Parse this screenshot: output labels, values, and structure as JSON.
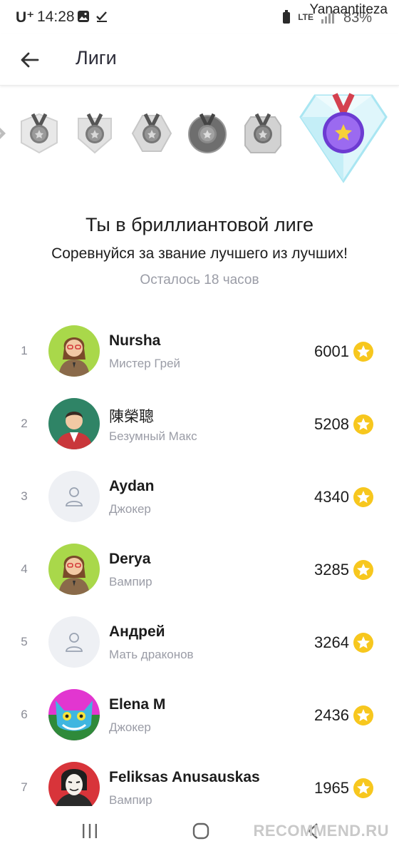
{
  "status_bar": {
    "carrier": "U⁺",
    "time": "14:28",
    "battery": "83%",
    "network": "LTE",
    "watermark": "Yanaantiteza"
  },
  "header": {
    "title": "Лиги"
  },
  "league": {
    "title": "Ты в бриллиантовой лиге",
    "subtitle": "Соревнуйся за звание лучшего из лучших!",
    "time_left": "Осталось 18 часов"
  },
  "leaderboard": [
    {
      "rank": "1",
      "name": "Nursha",
      "title": "Мистер Грей",
      "score": "6001",
      "avatar": "woman-glasses"
    },
    {
      "rank": "2",
      "name": "陳榮聰",
      "title": "Безумный Макс",
      "score": "5208",
      "avatar": "man-suit"
    },
    {
      "rank": "3",
      "name": "Aydan",
      "title": "Джокер",
      "score": "4340",
      "avatar": "placeholder"
    },
    {
      "rank": "4",
      "name": "Derya",
      "title": "Вампир",
      "score": "3285",
      "avatar": "woman-glasses"
    },
    {
      "rank": "5",
      "name": "Андрей",
      "title": "Мать драконов",
      "score": "3264",
      "avatar": "placeholder"
    },
    {
      "rank": "6",
      "name": "Elena M",
      "title": "Джокер",
      "score": "2436",
      "avatar": "cheshire-cat"
    },
    {
      "rank": "7",
      "name": "Feliksas Anusauskas",
      "title": "Вампир",
      "score": "1965",
      "avatar": "mask"
    }
  ],
  "footer": {
    "watermark": "RECOMMEND.RU"
  },
  "colors": {
    "accent_purple": "#8e5ae8",
    "coin_yellow": "#f7c71e",
    "diamond_cyan": "#cbeff7",
    "muted_text": "#9a9ca6"
  }
}
